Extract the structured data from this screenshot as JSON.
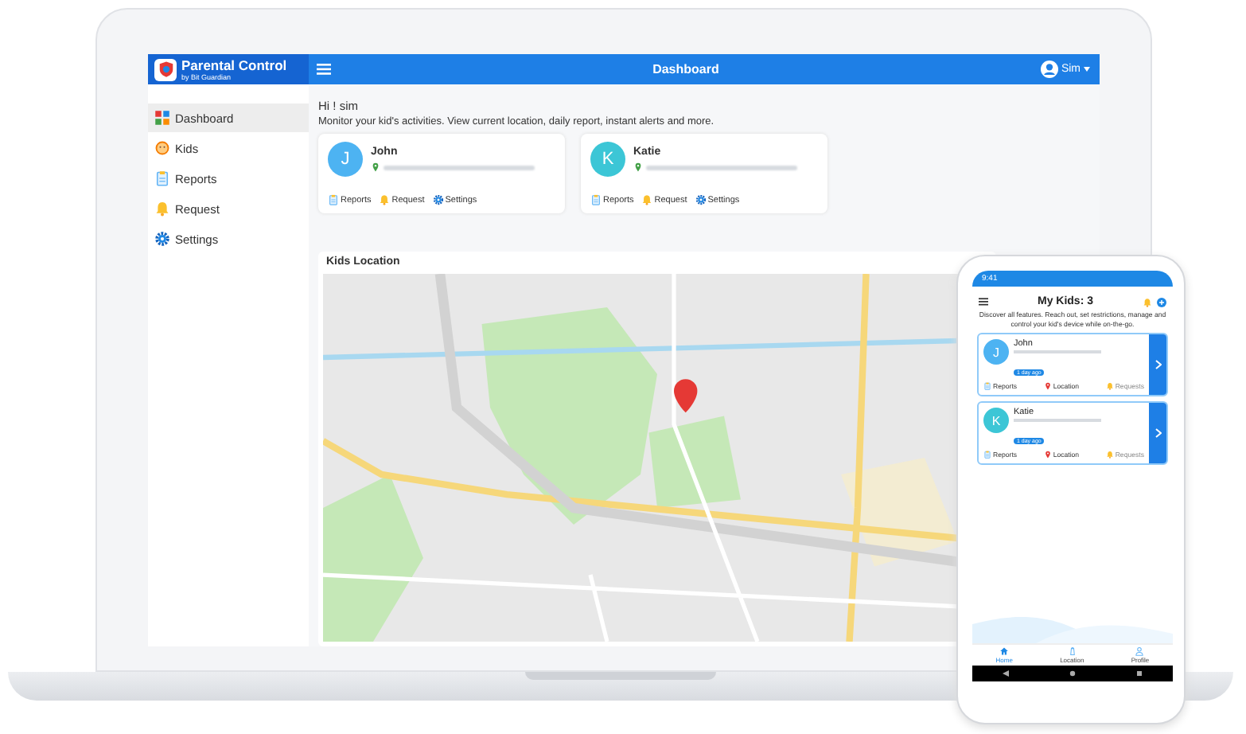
{
  "laptop": {
    "logo": {
      "title": "Parental Control",
      "subtitle": "by Bit Guardian"
    },
    "header": {
      "title": "Dashboard",
      "user": "Sim"
    },
    "sidebar": {
      "items": [
        {
          "label": "Dashboard",
          "kind": "dashboard",
          "selected": true
        },
        {
          "label": "Kids",
          "kind": "kids",
          "selected": false
        },
        {
          "label": "Reports",
          "kind": "reports",
          "selected": false
        },
        {
          "label": "Request",
          "kind": "request",
          "selected": false
        },
        {
          "label": "Settings",
          "kind": "settings",
          "selected": false
        }
      ]
    },
    "greeting": "Hi ! sim",
    "intro": "Monitor your kid's activities. View current location, daily report, instant alerts and more.",
    "kids": [
      {
        "initial": "J",
        "name": "John",
        "color": "#4db3f2",
        "actions": [
          {
            "label": "Reports",
            "kind": "reports"
          },
          {
            "label": "Request",
            "kind": "request"
          },
          {
            "label": "Settings",
            "kind": "settings"
          }
        ]
      },
      {
        "initial": "K",
        "name": "Katie",
        "color": "#3cc6d6",
        "actions": [
          {
            "label": "Reports",
            "kind": "reports"
          },
          {
            "label": "Request",
            "kind": "request"
          },
          {
            "label": "Settings",
            "kind": "settings"
          }
        ]
      }
    ],
    "location_panel": {
      "title": "Kids Location"
    }
  },
  "phone": {
    "time": "9:41",
    "title": "My Kids: 3",
    "intro": "Discover all features. Reach out, set restrictions, manage and control your kid's device while on-the-go.",
    "kids": [
      {
        "initial": "J",
        "name": "John",
        "color": "#4db3f2",
        "badge": "1 day ago",
        "actions": [
          {
            "label": "Reports",
            "kind": "reports",
            "disabled": false
          },
          {
            "label": "Location",
            "kind": "location",
            "disabled": false
          },
          {
            "label": "Requests",
            "kind": "request",
            "disabled": true
          }
        ]
      },
      {
        "initial": "K",
        "name": "Katie",
        "color": "#3cc6d6",
        "badge": "1 day ago",
        "actions": [
          {
            "label": "Reports",
            "kind": "reports",
            "disabled": false
          },
          {
            "label": "Location",
            "kind": "location",
            "disabled": false
          },
          {
            "label": "Requests",
            "kind": "request",
            "disabled": true
          }
        ]
      }
    ],
    "nav": [
      {
        "label": "Home",
        "kind": "home",
        "selected": true
      },
      {
        "label": "Location",
        "kind": "tower",
        "selected": false
      },
      {
        "label": "Profile",
        "kind": "profile",
        "selected": false
      }
    ]
  }
}
